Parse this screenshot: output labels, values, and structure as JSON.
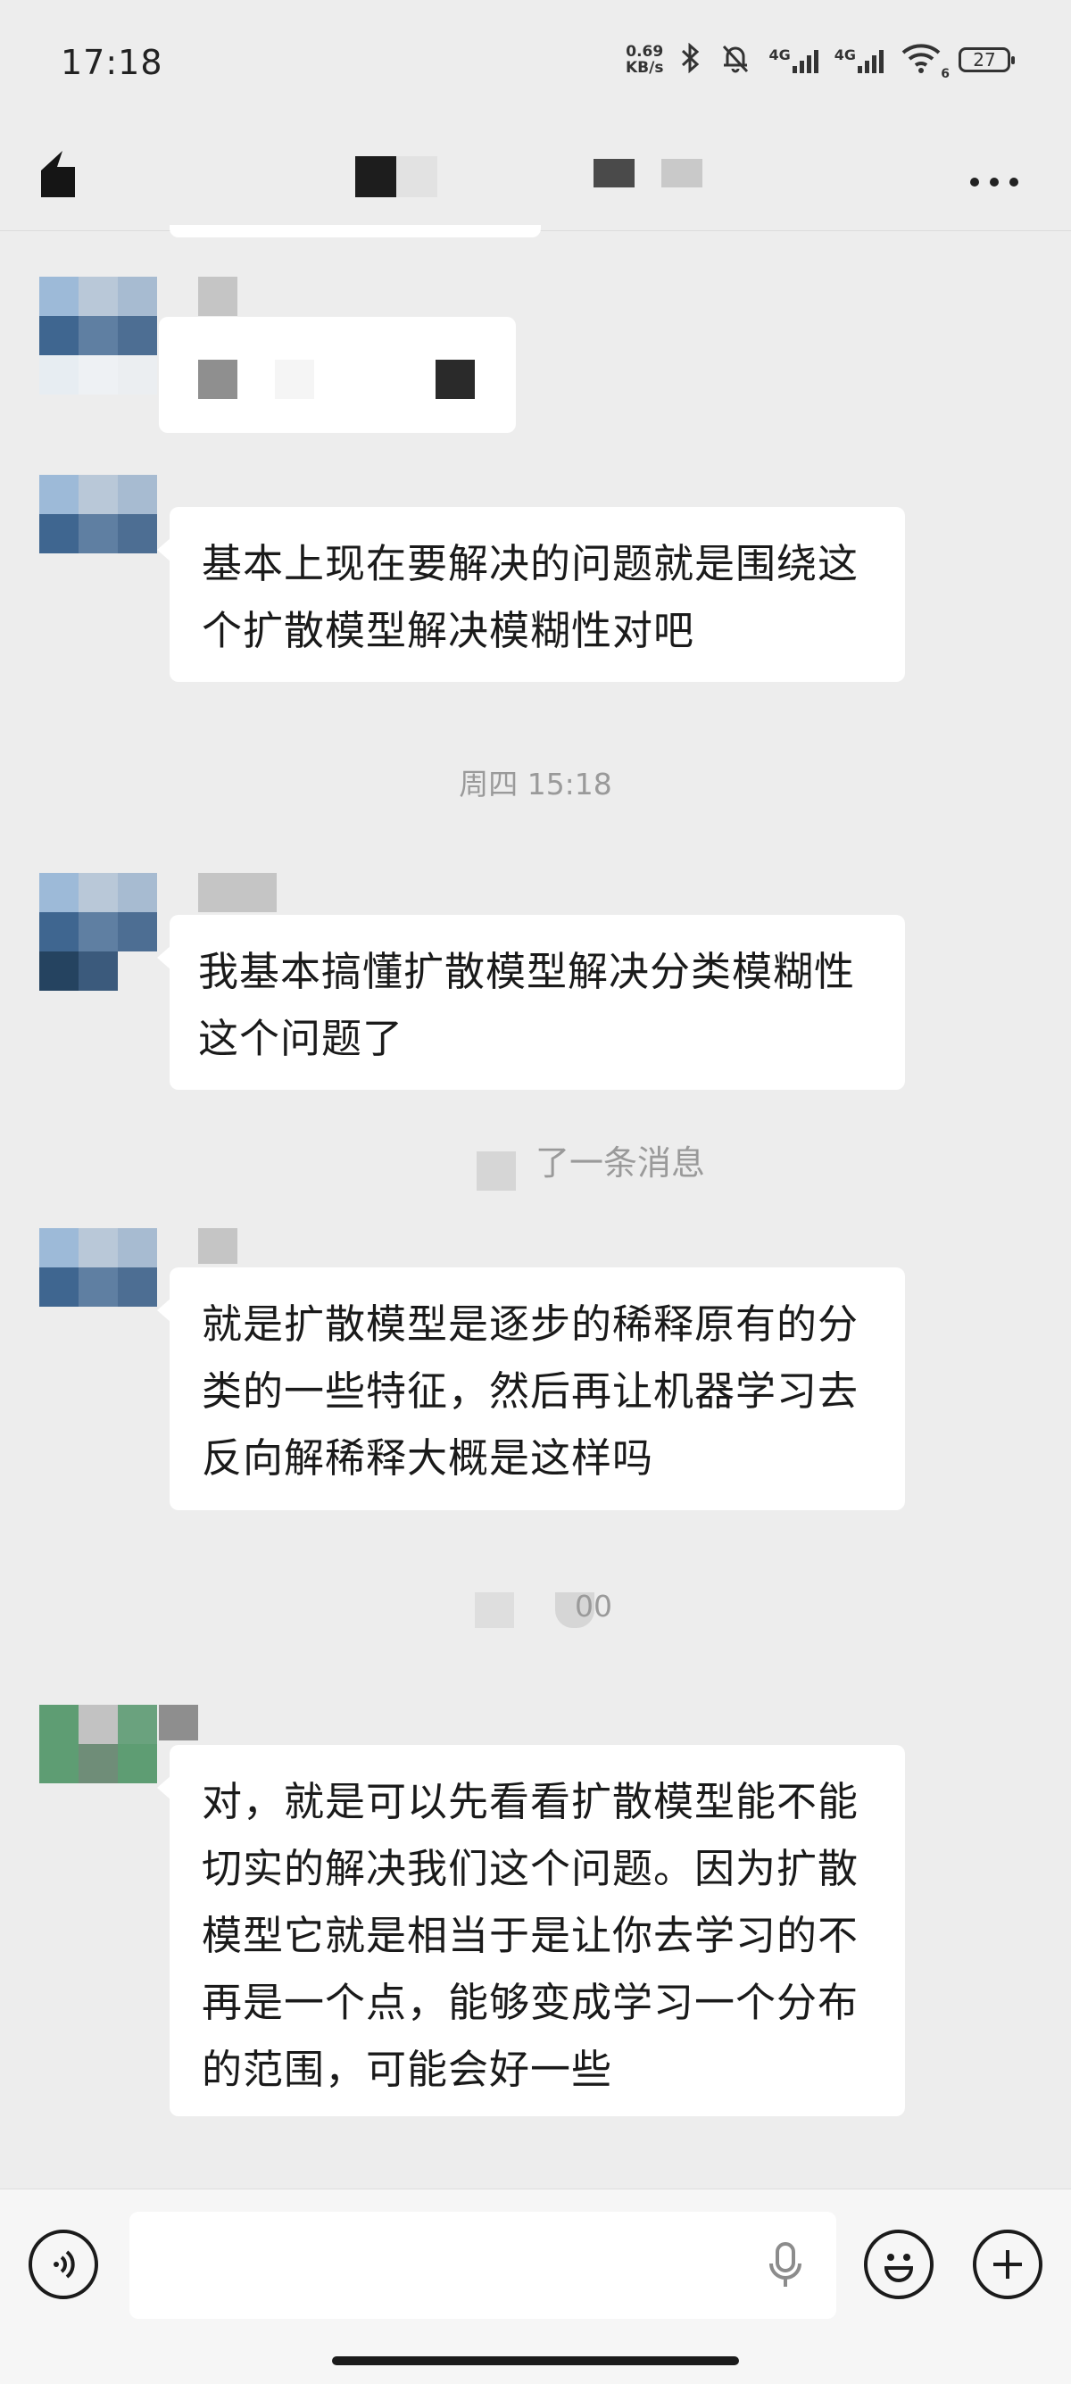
{
  "status_bar": {
    "time": "17:18",
    "net_speed_value": "0.69",
    "net_speed_unit": "KB/s",
    "signal1_label": "4G",
    "signal2_label": "4G",
    "wifi_sub": "6",
    "battery": "27"
  },
  "messages": [
    {
      "text": "基本上现在要解决的问题就是围绕这个扩散模型解决模糊性对吧"
    },
    {
      "text": "我基本搞懂扩散模型解决分类模糊性这个问题了"
    },
    {
      "text": "就是扩散模型是逐步的稀释原有的分类的一些特征，然后再让机器学习去反向解稀释大概是这样吗"
    },
    {
      "text": "对，就是可以先看看扩散模型能不能切实的解决我们这个问题。因为扩散模型它就是相当于是让你去学习的不再是一个点，能够变成学习一个分布的范围，可能会好一些"
    }
  ],
  "timestamps": {
    "t1": "周四 15:18"
  },
  "system_notice": "了一条消息",
  "redacted_timestamp_tail": "00",
  "input": {
    "value": "",
    "placeholder": ""
  },
  "colors": {
    "background": "#ededed",
    "bubble": "#ffffff",
    "timestamp": "#9a9a9a"
  }
}
